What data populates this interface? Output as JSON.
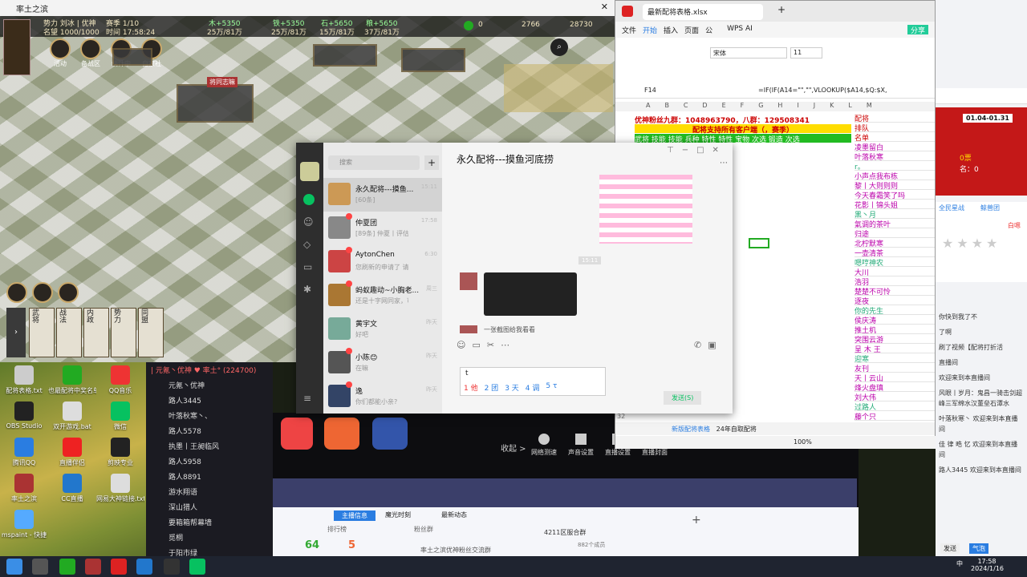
{
  "game": {
    "title": "率土之滨",
    "power": "势力 刘冰 | 优神",
    "honor": "名望 1000/1000",
    "round": "赛季 1/10",
    "time": "时间 17:58:24",
    "res": [
      {
        "gain": "木+5350",
        "amt": "25万/81万"
      },
      {
        "gain": "铁+5350",
        "amt": "25万/81万"
      },
      {
        "gain": "石+5650",
        "amt": "15万/81万"
      },
      {
        "gain": "粮+5650",
        "amt": "37万/81万"
      }
    ],
    "counts": [
      "0",
      "2766",
      "28730"
    ],
    "menu": [
      "活动",
      "备战区",
      "统计中",
      "自家社"
    ],
    "place": "将同志嘛",
    "cards": [
      "武将",
      "战法",
      "内政",
      "势力",
      "同盟"
    ]
  },
  "excel": {
    "tab": "最新配将表格.xlsx",
    "ribbon": [
      "文件",
      "开始",
      "插入",
      "页面",
      "公"
    ],
    "wps": "WPS AI",
    "share": "分享",
    "font": "宋体",
    "size": "11",
    "cellref": "F14",
    "formula": "=IF(IF(A14=\"\",\"\",VLOOKUP($A14,$Q:$X,",
    "r1": "优神粉丝九群：1048963790，八群：129508341",
    "r2": "配将支持所有客户端（，赛季）",
    "r3": "武将  技能  技能  兵种  特性  特性  宝物  次选  锻造  次选",
    "names": [
      "配将",
      "排队",
      "名单",
      "凌墨留白",
      "叶落秋寒",
      "r。",
      "小声点我布栋",
      "黎丨大则则则",
      "今天春霜笑了吗",
      "花影丨锦头姐",
      "黑丶月",
      "氣调的茶叶",
      "归途",
      "北柠默寒",
      "一壶清茶",
      "嗯哼神农",
      "大川",
      "浩羽",
      "楚楚不可怜",
      "逐夜",
      "你的先生",
      "侯庆涛",
      "推土机",
      "突围云游",
      "呈 木 王",
      "迎寒",
      "友刊",
      "天丨云山",
      "烽火盘瑱",
      "刘大伟",
      "过路人",
      "藤个只"
    ],
    "sheets": [
      "新版配将表格",
      "24年自取配将"
    ],
    "zoom": "100%",
    "rowno": "32"
  },
  "chat": {
    "title": "永久配将---摸鱼河底捞",
    "search": "搜索",
    "items": [
      {
        "name": "永久配将---摸鱼...",
        "prev": "[60条]",
        "time": "15:11"
      },
      {
        "name": "仲夏团",
        "prev": "[89条] 仲夏丨评估: ...",
        "time": "17:58"
      },
      {
        "name": "AytonChen",
        "prev": "您刷新的申请了 请您刷...",
        "time": "6:30"
      },
      {
        "name": "蚂蚁趣动~小胸老...",
        "prev": "还是十字网同家，可以...",
        "time": "周三"
      },
      {
        "name": "黄宇文",
        "prev": "好吧",
        "time": "昨天"
      },
      {
        "name": "小陈😊",
        "prev": "在嘛",
        "time": "昨天"
      },
      {
        "name": "逸",
        "prev": "你们都能小亲?",
        "time": "昨天"
      }
    ],
    "ts": "15:11",
    "msg": "一张截图给我看看",
    "input": "t",
    "cands": [
      "1 他",
      "2 团",
      "3 天",
      "4 调",
      "5 τ"
    ],
    "send": "发送(S)"
  },
  "live": {
    "header": "| 元氪丶优神 ♥ 率土° (224700)",
    "users": [
      "元氪丶优神",
      "路人3445",
      "叶落秋寒丶、",
      "路人5578",
      "执墨丨王昶临风",
      "路人5958",
      "路人8891",
      "游水翔语",
      "深山猎人",
      "要箱箱帮幕墙",
      "觅桐",
      "于阳市绿"
    ]
  },
  "stream": {
    "btns": [
      "网络测速",
      "声音设置",
      "直播设置",
      "直播封面"
    ],
    "collapse": "收起 >",
    "tabs": [
      "主播信息",
      "魔光时刻",
      "最新动态"
    ],
    "rank": "排行榜",
    "fans": "粉丝群",
    "group": "4211区服合群",
    "grpsub": "率土之滨优神粉丝交流群",
    "members": "882个成员",
    "n1": "64",
    "n2": "5"
  },
  "right": {
    "date": "01.04-01.31",
    "a": "0票",
    "b": "名：0",
    "rules": "全民星战",
    "tab": "鲸兽团",
    "rating": "白嗯",
    "msgs": [
      "你快到我了不",
      "了啊",
      "刷了视频【配将打折活",
      "直播间",
      "欢迎来到本直播间",
      "风眼丨岁月：鬼昌一骑击剑超峰三军绵水汉董垒石潭水",
      "叶落秋寒丶 欢迎来到本直播间",
      "佳 律 晧 忆 欢迎来到本直播间",
      "路人3445 欢迎来到本直播间"
    ],
    "send1": "发送",
    "send2": "气泡"
  },
  "desk": {
    "icons": [
      "配将表格.txt",
      "也最配将中奖名单.xlsx",
      "QQ音乐",
      "OBS Studio",
      "双开游戏.bat",
      "微信",
      "腾讯QQ",
      "直播伴侣",
      "剪映专业",
      "率土之滨",
      "CC直播",
      "网易大神链接.txt",
      "mspaint - 快捷"
    ]
  },
  "task": {
    "time": "17:58",
    "date": "2024/1/16",
    "lang": "中"
  }
}
